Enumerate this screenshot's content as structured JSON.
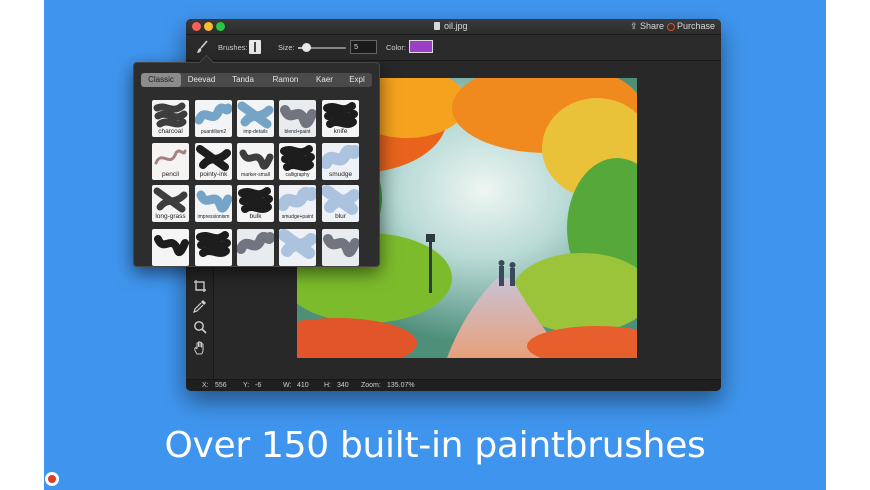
{
  "window": {
    "title": "oil.jpg",
    "share_label": "Share",
    "purchase_label": "Purchase"
  },
  "toolbar": {
    "brushes_label": "Brushes:",
    "size_label": "Size:",
    "size_value": "5",
    "size_slider_fraction": 0.16,
    "color_label": "Color:",
    "color_value": "#9b3fc6"
  },
  "brush_panel": {
    "tabs": [
      {
        "label": "Classic",
        "active": true
      },
      {
        "label": "Deevad",
        "active": false
      },
      {
        "label": "Tanda",
        "active": false
      },
      {
        "label": "Ramon",
        "active": false
      },
      {
        "label": "Kaer",
        "active": false
      },
      {
        "label": "Expl",
        "active": false
      }
    ],
    "rows": [
      [
        {
          "label": "charcoal",
          "style": "dark"
        },
        {
          "label": "puantilism2",
          "style": "blue"
        },
        {
          "label": "imp-details",
          "style": "blue"
        },
        {
          "label": "blend+paint",
          "style": "gray"
        },
        {
          "label": "knife",
          "style": "black"
        }
      ],
      [
        {
          "label": "pencil",
          "style": "pencil"
        },
        {
          "label": "pointy-ink",
          "style": "black"
        },
        {
          "label": "marker-small",
          "style": "dark"
        },
        {
          "label": "calligraphy",
          "style": "black"
        },
        {
          "label": "smudge",
          "style": "lightblue"
        }
      ],
      [
        {
          "label": "long-grass",
          "style": "dark"
        },
        {
          "label": "impressionism",
          "style": "blue"
        },
        {
          "label": "bulk",
          "style": "black"
        },
        {
          "label": "smudge+paint",
          "style": "lightblue"
        },
        {
          "label": "blur",
          "style": "lightblue"
        }
      ],
      [
        {
          "label": "",
          "style": "black"
        },
        {
          "label": "",
          "style": "black"
        },
        {
          "label": "",
          "style": "gray"
        },
        {
          "label": "",
          "style": "lightblue"
        },
        {
          "label": "",
          "style": "gray"
        }
      ]
    ]
  },
  "status": {
    "x_label": "X:",
    "x_value": "556",
    "y_label": "Y:",
    "y_value": "-6",
    "w_label": "W:",
    "w_value": "410",
    "h_label": "H:",
    "h_value": "340",
    "zoom_label": "Zoom:",
    "zoom_value": "135.07%"
  },
  "headline": "Over 150 built-in paintbrushes",
  "icons": {
    "brush_tool": "paintbrush-icon",
    "crop": "crop-icon",
    "eyedropper": "eyedropper-icon",
    "zoom": "magnifier-icon",
    "hand": "hand-icon"
  },
  "colors": {
    "background": "#3f95ee",
    "window": "#232323",
    "selected_color": "#9b3fc6"
  }
}
